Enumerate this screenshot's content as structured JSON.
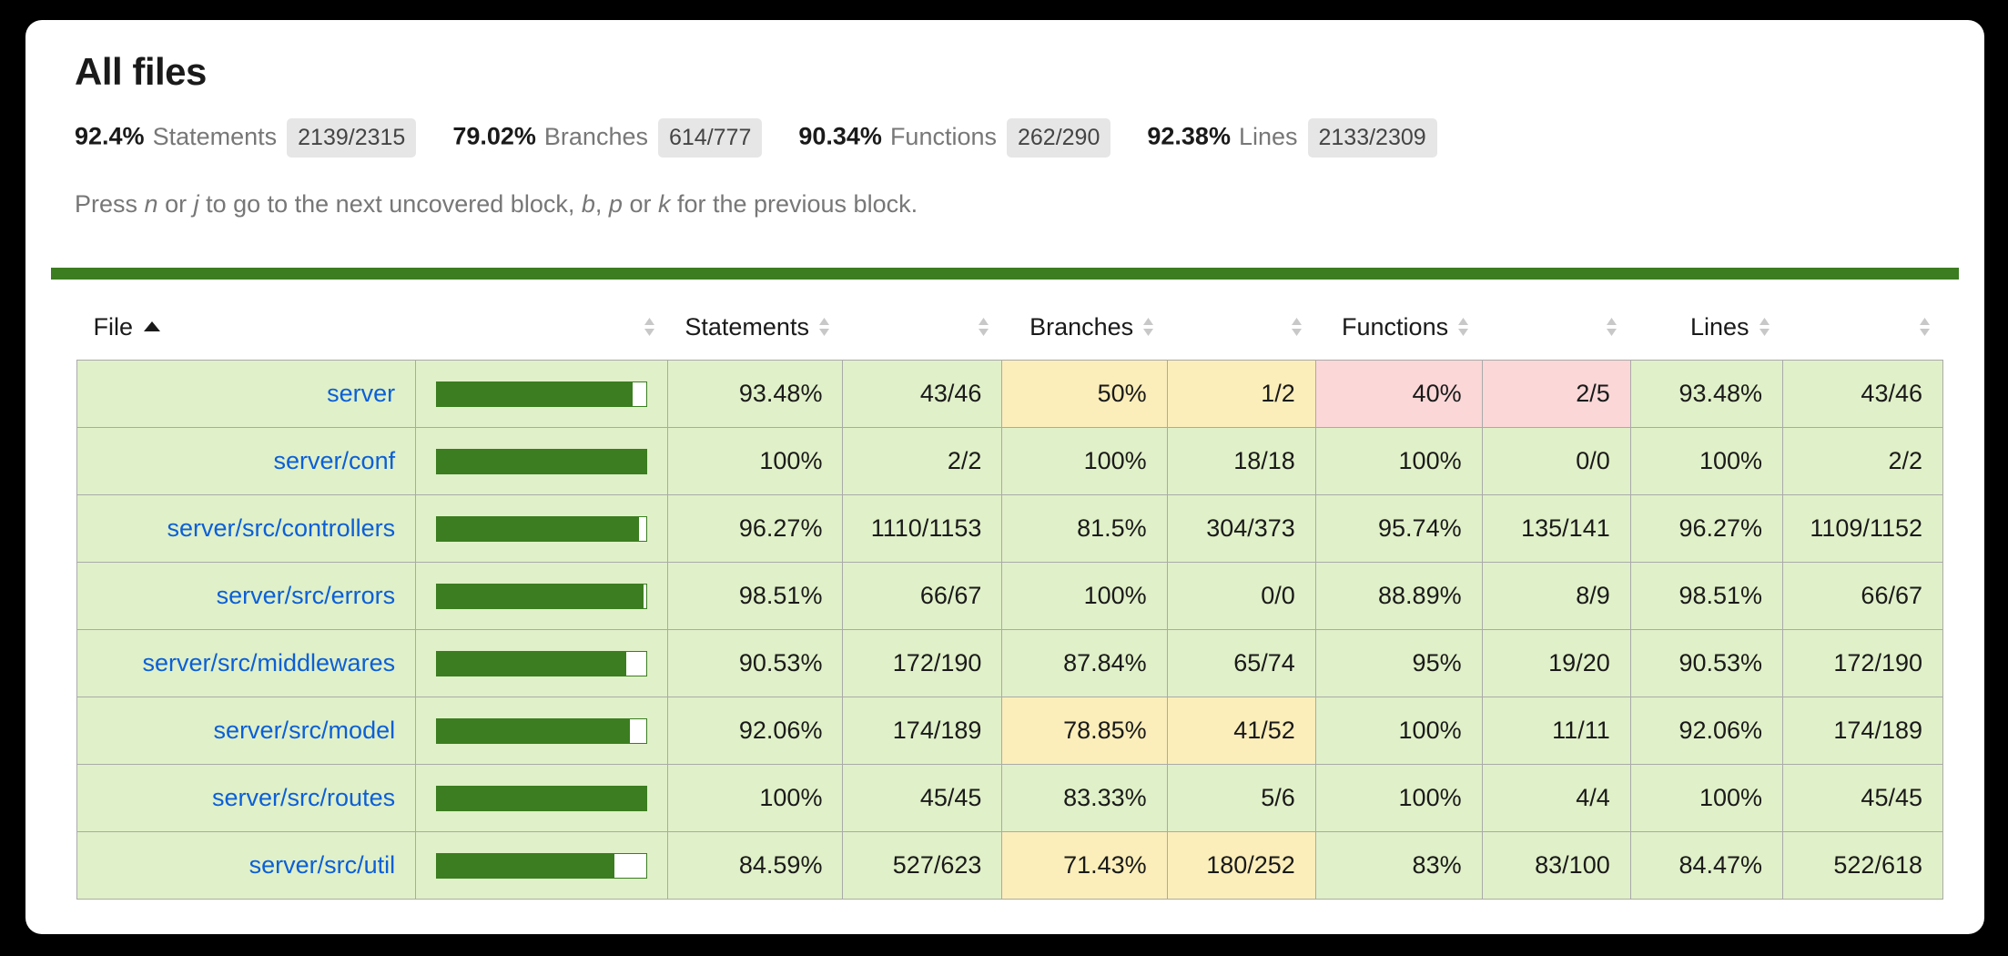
{
  "page_title": "All files",
  "summary": [
    {
      "pct": "92.4%",
      "label": "Statements",
      "fraction": "2139/2315"
    },
    {
      "pct": "79.02%",
      "label": "Branches",
      "fraction": "614/777"
    },
    {
      "pct": "90.34%",
      "label": "Functions",
      "fraction": "262/290"
    },
    {
      "pct": "92.38%",
      "label": "Lines",
      "fraction": "2133/2309"
    }
  ],
  "hint": {
    "p1": "Press ",
    "k1": "n",
    "p2": " or ",
    "k2": "j",
    "p3": " to go to the next uncovered block, ",
    "k3": "b",
    "p4": ", ",
    "k4": "p",
    "p5": " or ",
    "k5": "k",
    "p6": " for the previous block."
  },
  "table": {
    "headers": {
      "file": "File",
      "statements": "Statements",
      "branches": "Branches",
      "functions": "Functions",
      "lines": "Lines"
    },
    "sort_column": "File",
    "sort_direction": "asc",
    "rows": [
      {
        "file": "server",
        "bar_pct": 93.48,
        "statements_pct": "93.48%",
        "statements_pct_class": "high",
        "statements_abs": "43/46",
        "statements_abs_class": "high",
        "branches_pct": "50%",
        "branches_pct_class": "medium",
        "branches_abs": "1/2",
        "branches_abs_class": "medium",
        "functions_pct": "40%",
        "functions_pct_class": "low",
        "functions_abs": "2/5",
        "functions_abs_class": "low",
        "lines_pct": "93.48%",
        "lines_pct_class": "high",
        "lines_abs": "43/46",
        "lines_abs_class": "high"
      },
      {
        "file": "server/conf",
        "bar_pct": 100,
        "statements_pct": "100%",
        "statements_pct_class": "high",
        "statements_abs": "2/2",
        "statements_abs_class": "high",
        "branches_pct": "100%",
        "branches_pct_class": "high",
        "branches_abs": "18/18",
        "branches_abs_class": "high",
        "functions_pct": "100%",
        "functions_pct_class": "high",
        "functions_abs": "0/0",
        "functions_abs_class": "high",
        "lines_pct": "100%",
        "lines_pct_class": "high",
        "lines_abs": "2/2",
        "lines_abs_class": "high"
      },
      {
        "file": "server/src/controllers",
        "bar_pct": 96.27,
        "statements_pct": "96.27%",
        "statements_pct_class": "high",
        "statements_abs": "1110/1153",
        "statements_abs_class": "high",
        "branches_pct": "81.5%",
        "branches_pct_class": "high",
        "branches_abs": "304/373",
        "branches_abs_class": "high",
        "functions_pct": "95.74%",
        "functions_pct_class": "high",
        "functions_abs": "135/141",
        "functions_abs_class": "high",
        "lines_pct": "96.27%",
        "lines_pct_class": "high",
        "lines_abs": "1109/1152",
        "lines_abs_class": "high"
      },
      {
        "file": "server/src/errors",
        "bar_pct": 98.51,
        "statements_pct": "98.51%",
        "statements_pct_class": "high",
        "statements_abs": "66/67",
        "statements_abs_class": "high",
        "branches_pct": "100%",
        "branches_pct_class": "high",
        "branches_abs": "0/0",
        "branches_abs_class": "high",
        "functions_pct": "88.89%",
        "functions_pct_class": "high",
        "functions_abs": "8/9",
        "functions_abs_class": "high",
        "lines_pct": "98.51%",
        "lines_pct_class": "high",
        "lines_abs": "66/67",
        "lines_abs_class": "high"
      },
      {
        "file": "server/src/middlewares",
        "bar_pct": 90.53,
        "statements_pct": "90.53%",
        "statements_pct_class": "high",
        "statements_abs": "172/190",
        "statements_abs_class": "high",
        "branches_pct": "87.84%",
        "branches_pct_class": "high",
        "branches_abs": "65/74",
        "branches_abs_class": "high",
        "functions_pct": "95%",
        "functions_pct_class": "high",
        "functions_abs": "19/20",
        "functions_abs_class": "high",
        "lines_pct": "90.53%",
        "lines_pct_class": "high",
        "lines_abs": "172/190",
        "lines_abs_class": "high"
      },
      {
        "file": "server/src/model",
        "bar_pct": 92.06,
        "statements_pct": "92.06%",
        "statements_pct_class": "high",
        "statements_abs": "174/189",
        "statements_abs_class": "high",
        "branches_pct": "78.85%",
        "branches_pct_class": "medium",
        "branches_abs": "41/52",
        "branches_abs_class": "medium",
        "functions_pct": "100%",
        "functions_pct_class": "high",
        "functions_abs": "11/11",
        "functions_abs_class": "high",
        "lines_pct": "92.06%",
        "lines_pct_class": "high",
        "lines_abs": "174/189",
        "lines_abs_class": "high"
      },
      {
        "file": "server/src/routes",
        "bar_pct": 100,
        "statements_pct": "100%",
        "statements_pct_class": "high",
        "statements_abs": "45/45",
        "statements_abs_class": "high",
        "branches_pct": "83.33%",
        "branches_pct_class": "high",
        "branches_abs": "5/6",
        "branches_abs_class": "high",
        "functions_pct": "100%",
        "functions_pct_class": "high",
        "functions_abs": "4/4",
        "functions_abs_class": "high",
        "lines_pct": "100%",
        "lines_pct_class": "high",
        "lines_abs": "45/45",
        "lines_abs_class": "high"
      },
      {
        "file": "server/src/util",
        "bar_pct": 84.59,
        "statements_pct": "84.59%",
        "statements_pct_class": "high",
        "statements_abs": "527/623",
        "statements_abs_class": "high",
        "branches_pct": "71.43%",
        "branches_pct_class": "medium",
        "branches_abs": "180/252",
        "branches_abs_class": "medium",
        "functions_pct": "83%",
        "functions_pct_class": "high",
        "functions_abs": "83/100",
        "functions_abs_class": "high",
        "lines_pct": "84.47%",
        "lines_pct_class": "high",
        "lines_abs": "522/618",
        "lines_abs_class": "high"
      }
    ]
  },
  "colors": {
    "status_bar": "#3b7d20",
    "high": "#e0f0c8",
    "medium": "#fbeeba",
    "low": "#fbd7d7",
    "link": "#0b5fd8",
    "cover_fill": "#3b7d20"
  }
}
